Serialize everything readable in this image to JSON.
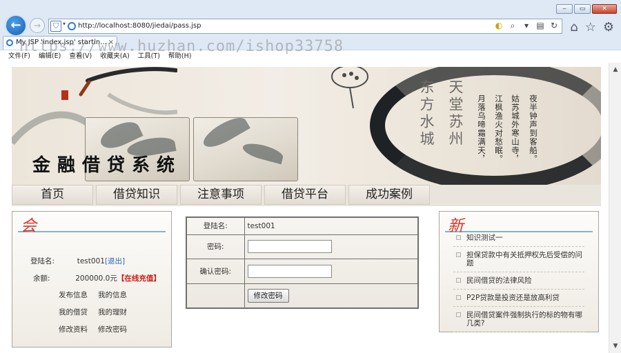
{
  "browser": {
    "window_buttons": [
      "‒",
      "▭",
      "✕"
    ],
    "address": "http://localhost:8080/jiedai/pass.jsp",
    "tab_title": "My JSP 'index.jsp' startin...",
    "tab_close": "×",
    "menu": [
      "文件(F)",
      "编辑(E)",
      "查看(V)",
      "收藏夹(A)",
      "工具(T)",
      "帮助(H)"
    ],
    "watermark": "https://www.huzhan.com/ishop33758"
  },
  "banner": {
    "title": "金融借贷系统",
    "poem_big": [
      "天堂苏州",
      "东方水城"
    ],
    "poem_small": [
      "夜半钟声到客船。",
      "姑苏城外寒山寺，",
      "江枫渔火对愁眠。",
      "月落乌啼霜满天，"
    ]
  },
  "nav": {
    "items": [
      "首页",
      "借贷知识",
      "注意事项",
      "借贷平台",
      "成功案例"
    ]
  },
  "member_panel": {
    "head_char": "会",
    "login_label": "登陆名:",
    "login_value": "test001",
    "logout": "[退出]",
    "balance_label": "余额:",
    "balance_value": "200000.0元",
    "recharge": "【在线充值】",
    "links": [
      "发布信息",
      "我的信息",
      "我的借贷",
      "我的理财",
      "修改资料",
      "修改密码"
    ]
  },
  "password_form": {
    "login_label": "登陆名:",
    "login_value": "test001",
    "password_label": "密码:",
    "password_value": "",
    "confirm_label": "确认密码:",
    "confirm_value": "",
    "submit_label": "修改密码"
  },
  "news_panel": {
    "head_char": "新",
    "items": [
      "知识测试一",
      "担保贷款中有关抵押权先后受偿的问题",
      "民间借贷的法律风险",
      "P2P贷款是投资还是放高利贷",
      "民间借贷案件强制执行的标的物有哪几类?"
    ]
  }
}
